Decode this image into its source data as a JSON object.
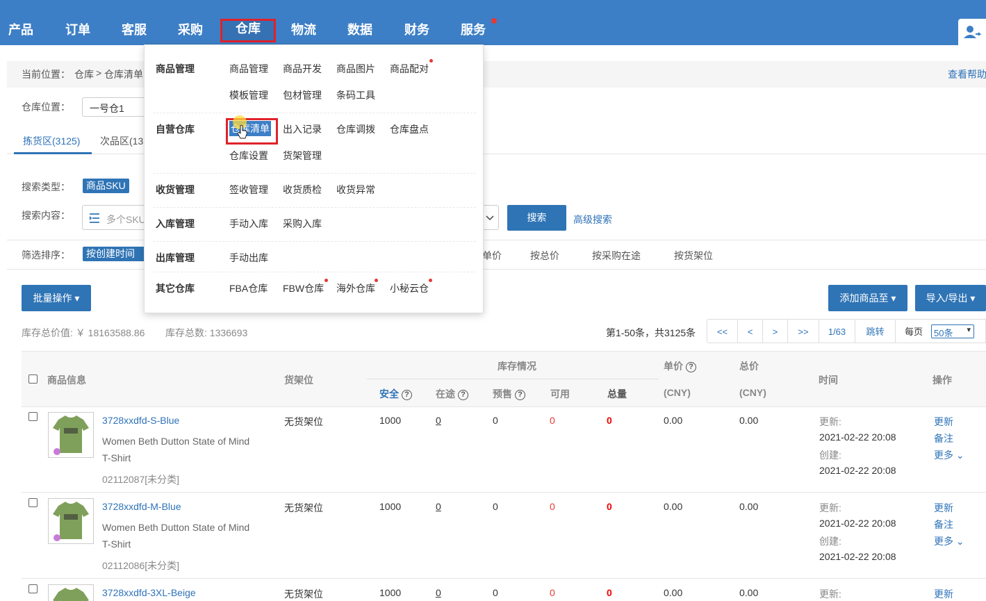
{
  "nav": {
    "items": [
      "产品",
      "订单",
      "客服",
      "采购",
      "仓库",
      "物流",
      "数据",
      "财务",
      "服务"
    ]
  },
  "breadcrumb": {
    "prefix": "当前位置：",
    "path1": "仓库",
    "sep": ">",
    "path2": "仓库清单",
    "help": "查看帮助"
  },
  "warehouse": {
    "label": "仓库位置：",
    "value": "一号仓1"
  },
  "tabs": [
    "拣货区(3125)",
    "次品区(13"
  ],
  "search": {
    "type_label": "搜索类型：",
    "type_value": "商品SKU",
    "content_label": "搜索内容：",
    "placeholder": "多个SKU",
    "button": "搜索",
    "advanced": "高级搜索"
  },
  "sort": {
    "label": "筛选排序：",
    "selected": "按创建时间",
    "options": [
      "单价",
      "按总价",
      "按采购在途",
      "按货架位"
    ]
  },
  "actions": {
    "batch": "批量操作",
    "add_to": "添加商品至",
    "import_export": "导入/导出"
  },
  "summary": {
    "total_value": "库存总价值: ￥ 18163588.86",
    "total_count": "库存总数: 1336693"
  },
  "pager": {
    "info": "第1-50条，共3125条",
    "first": "<<",
    "prev": "<",
    "next": ">",
    "last": ">>",
    "page": "1/63",
    "jump": "跳转",
    "per_page_label": "每页",
    "per_page": "50条"
  },
  "menu": {
    "groups": [
      {
        "title": "商品管理",
        "items": [
          "商品管理",
          "商品开发",
          "商品图片",
          "商品配对",
          "模板管理",
          "包材管理",
          "条码工具"
        ]
      },
      {
        "title": "自营仓库",
        "items": [
          "仓库清单",
          "出入记录",
          "仓库调拨",
          "仓库盘点",
          "仓库设置",
          "货架管理"
        ]
      },
      {
        "title": "收货管理",
        "items": [
          "签收管理",
          "收货质检",
          "收货异常"
        ]
      },
      {
        "title": "入库管理",
        "items": [
          "手动入库",
          "采购入库"
        ]
      },
      {
        "title": "出库管理",
        "items": [
          "手动出库"
        ]
      },
      {
        "title": "其它仓库",
        "items": [
          "FBA仓库",
          "FBW仓库",
          "海外仓库",
          "小秘云仓"
        ]
      }
    ]
  },
  "table": {
    "headers": {
      "product": "商品信息",
      "shelf": "货架位",
      "stock": "库存情况",
      "safe": "安全",
      "transit": "在途",
      "presale": "预售",
      "available": "可用",
      "total": "总量",
      "unit_price": "单价",
      "unit_cny": "(CNY)",
      "total_price": "总价",
      "total_cny": "(CNY)",
      "time": "时间",
      "ops": "操作"
    },
    "rows": [
      {
        "sku": "3728xxdfd-S-Blue",
        "name1": "Women Beth Dutton State of Mind",
        "name2": "T-Shirt",
        "code": "02112087[未分类]",
        "shelf": "无货架位",
        "safe": "1000",
        "transit": "0",
        "presale": "0",
        "available": "0",
        "total": "0",
        "unit_price": "0.00",
        "total_price": "0.00",
        "upd_label": "更新:",
        "upd": "2021-02-22 20:08",
        "cre_label": "创建:",
        "cre": "2021-02-22 20:08",
        "op1": "更新",
        "op2": "备注",
        "op3": "更多"
      },
      {
        "sku": "3728xxdfd-M-Blue",
        "name1": "Women Beth Dutton State of Mind",
        "name2": "T-Shirt",
        "code": "02112086[未分类]",
        "shelf": "无货架位",
        "safe": "1000",
        "transit": "0",
        "presale": "0",
        "available": "0",
        "total": "0",
        "unit_price": "0.00",
        "total_price": "0.00",
        "upd_label": "更新:",
        "upd": "2021-02-22 20:08",
        "cre_label": "创建:",
        "cre": "2021-02-22 20:08",
        "op1": "更新",
        "op2": "备注",
        "op3": "更多"
      },
      {
        "sku": "3728xxdfd-3XL-Beige",
        "shelf": "无货架位",
        "safe": "1000",
        "transit": "0",
        "presale": "0",
        "available": "0",
        "total": "0",
        "unit_price": "0.00",
        "total_price": "0.00",
        "upd_label": "更新:",
        "op1": "更新"
      }
    ]
  },
  "colors": {
    "nav": "#3d7fc6",
    "accent": "#2f74b5",
    "highlight": "#e0222a"
  }
}
